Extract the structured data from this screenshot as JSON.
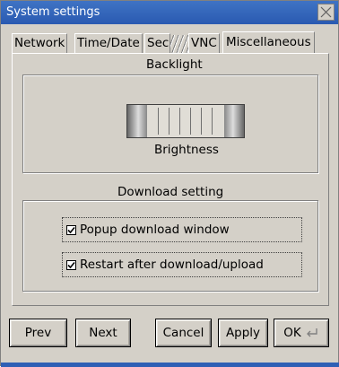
{
  "window": {
    "title": "System settings"
  },
  "tabs": [
    {
      "label": "Network"
    },
    {
      "label": "Time/Date"
    },
    {
      "label": "Sec"
    },
    {
      "label": "VNC"
    },
    {
      "label": "Miscellaneous"
    }
  ],
  "backlight": {
    "title": "Backlight",
    "slider_label": "Brightness"
  },
  "download": {
    "title": "Download setting",
    "options": [
      {
        "label": "Popup download window",
        "checked": true
      },
      {
        "label": "Restart after download/upload",
        "checked": true
      }
    ]
  },
  "buttons": {
    "prev": "Prev",
    "next": "Next",
    "cancel": "Cancel",
    "apply": "Apply",
    "ok": "OK"
  },
  "colors": {
    "titlebar": "#2a5ab1",
    "dialog_bg": "#d4d0c8"
  },
  "icons": {
    "close": "close-icon",
    "enter": "enter-icon",
    "check": "checkmark-icon"
  }
}
